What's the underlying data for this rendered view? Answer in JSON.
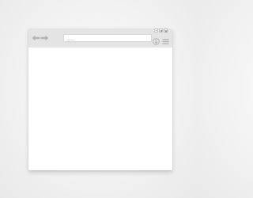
{
  "browser": {
    "address_bar": {
      "text": "___"
    },
    "icons": {
      "back": "arrow-left-icon",
      "forward": "arrow-right-icon",
      "action": "circle-arrow-icon",
      "menu": "hamburger-menu-icon",
      "minimize": "minimize-icon",
      "maximize": "maximize-icon",
      "close": "close-icon"
    },
    "colors": {
      "toolbar": "#e4e4e4",
      "icon": "#b4b4b4",
      "content": "#ffffff"
    }
  }
}
